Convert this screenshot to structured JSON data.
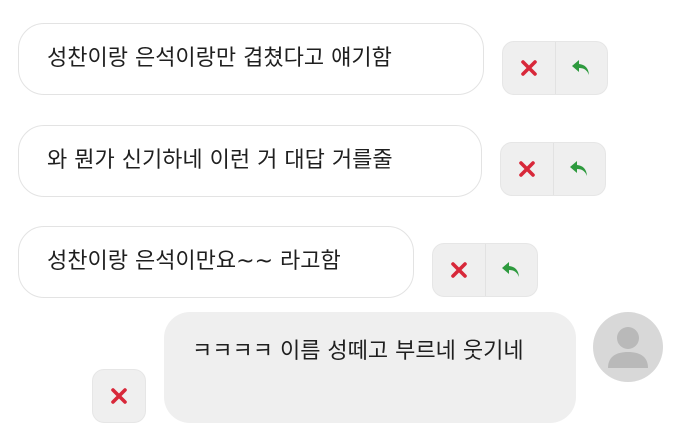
{
  "messages": [
    {
      "text": "성찬이랑 은석이랑만 겹쳤다고 얘기함"
    },
    {
      "text": "와 뭔가 신기하네 이런 거 대답 거를줄"
    },
    {
      "text": "성찬이랑 은석이만요~~ 라고함"
    },
    {
      "text": "ㅋㅋㅋㅋ 이름 성떼고 부르네 웃기네"
    }
  ],
  "icons": {
    "delete": "close-icon",
    "reply": "reply-arrow-icon",
    "avatar": "user-avatar-icon"
  },
  "colors": {
    "delete_red": "#d8283a",
    "reply_green": "#2e9a3e",
    "bubble_gray": "#efefef",
    "avatar_gray": "#d8d8d8"
  }
}
